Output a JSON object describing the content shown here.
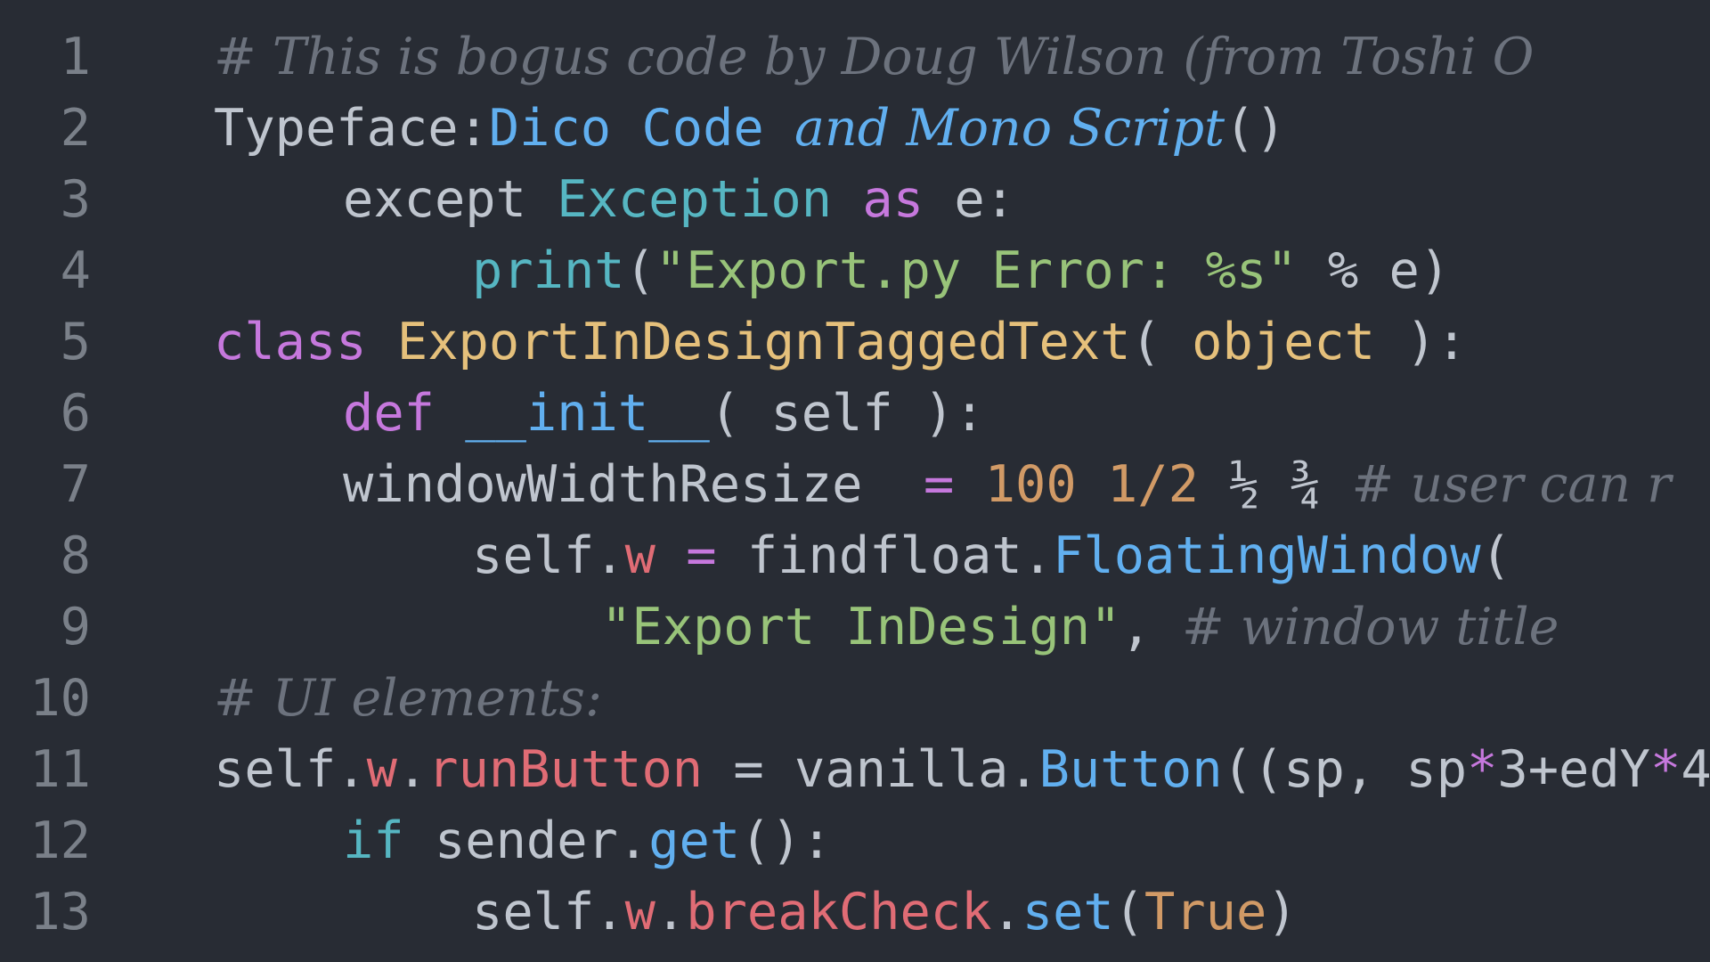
{
  "theme": {
    "background": "#282c34",
    "colors": {
      "default": "#bfc5ce",
      "gutter": "#7a8089",
      "comment": "#6c727d",
      "blue": "#61afef",
      "cyan": "#56b6c2",
      "purple": "#c678dd",
      "green": "#98c379",
      "orange": "#d19a66",
      "yellow": "#e5c07b",
      "red": "#e06c75"
    }
  },
  "lines": [
    {
      "num": "1",
      "indent": 0,
      "tokens": [
        {
          "t": "# This is bogus code by Doug Wilson (from Toshi O",
          "c": "comment"
        }
      ]
    },
    {
      "num": "2",
      "indent": 0,
      "tokens": [
        {
          "t": "Typeface:",
          "c": "default"
        },
        {
          "t": "Dico Code ",
          "c": "blue"
        },
        {
          "t": "and Mono Script",
          "c": "blue",
          "s": "script-italic"
        },
        {
          "t": "()",
          "c": "default"
        }
      ]
    },
    {
      "num": "3",
      "indent": 1,
      "tokens": [
        {
          "t": "except ",
          "c": "default"
        },
        {
          "t": "Exception",
          "c": "cyan"
        },
        {
          "t": " ",
          "c": "default"
        },
        {
          "t": "as",
          "c": "purple"
        },
        {
          "t": " e:",
          "c": "default"
        }
      ]
    },
    {
      "num": "4",
      "indent": 2,
      "tokens": [
        {
          "t": "print",
          "c": "cyan"
        },
        {
          "t": "(",
          "c": "default"
        },
        {
          "t": "\"Export.py Error: %s\"",
          "c": "green"
        },
        {
          "t": " % e)",
          "c": "default"
        }
      ]
    },
    {
      "num": "5",
      "indent": 0,
      "tokens": [
        {
          "t": "class ",
          "c": "purple"
        },
        {
          "t": "ExportInDesignTaggedText",
          "c": "yellow"
        },
        {
          "t": "( ",
          "c": "default"
        },
        {
          "t": "object",
          "c": "yellow"
        },
        {
          "t": " ):",
          "c": "default"
        }
      ]
    },
    {
      "num": "6",
      "indent": 1,
      "tokens": [
        {
          "t": "def ",
          "c": "purple"
        },
        {
          "t": "__init__",
          "c": "blue"
        },
        {
          "t": "( self ):",
          "c": "default"
        }
      ]
    },
    {
      "num": "7",
      "indent": 1,
      "tokens": [
        {
          "t": "windowWidthResize  ",
          "c": "default"
        },
        {
          "t": "=",
          "c": "purple"
        },
        {
          "t": " ",
          "c": "default"
        },
        {
          "t": "100 1/2",
          "c": "orange"
        },
        {
          "t": " ½ ¾ ",
          "c": "default"
        },
        {
          "t": "# user can r",
          "c": "comment"
        }
      ]
    },
    {
      "num": "8",
      "indent": 2,
      "tokens": [
        {
          "t": "self.",
          "c": "default"
        },
        {
          "t": "w",
          "c": "red"
        },
        {
          "t": " ",
          "c": "default"
        },
        {
          "t": "=",
          "c": "purple"
        },
        {
          "t": " findfloat.",
          "c": "default"
        },
        {
          "t": "FloatingWindow",
          "c": "blue"
        },
        {
          "t": "(",
          "c": "default"
        }
      ]
    },
    {
      "num": "9",
      "indent": 3,
      "tokens": [
        {
          "t": "\"Export InDesign\"",
          "c": "green"
        },
        {
          "t": ", ",
          "c": "default"
        },
        {
          "t": "# window title",
          "c": "comment"
        }
      ]
    },
    {
      "num": "10",
      "indent": 0,
      "tokens": [
        {
          "t": "# UI elements:",
          "c": "comment"
        }
      ]
    },
    {
      "num": "11",
      "indent": 0,
      "tokens": [
        {
          "t": "self.",
          "c": "default"
        },
        {
          "t": "w",
          "c": "red"
        },
        {
          "t": ".",
          "c": "default"
        },
        {
          "t": "runButton",
          "c": "red"
        },
        {
          "t": " = vanilla.",
          "c": "default"
        },
        {
          "t": "Button",
          "c": "blue"
        },
        {
          "t": "((sp, sp",
          "c": "default"
        },
        {
          "t": "*",
          "c": "purple"
        },
        {
          "t": "3+edY",
          "c": "default"
        },
        {
          "t": "*",
          "c": "purple"
        },
        {
          "t": "4",
          "c": "default"
        }
      ]
    },
    {
      "num": "12",
      "indent": 1,
      "tokens": [
        {
          "t": "if",
          "c": "cyan"
        },
        {
          "t": " sender.",
          "c": "default"
        },
        {
          "t": "get",
          "c": "blue"
        },
        {
          "t": "():",
          "c": "default"
        }
      ]
    },
    {
      "num": "13",
      "indent": 2,
      "tokens": [
        {
          "t": "self.",
          "c": "default"
        },
        {
          "t": "w",
          "c": "red"
        },
        {
          "t": ".",
          "c": "default"
        },
        {
          "t": "breakCheck",
          "c": "red"
        },
        {
          "t": ".",
          "c": "default"
        },
        {
          "t": "set",
          "c": "blue"
        },
        {
          "t": "(",
          "c": "default"
        },
        {
          "t": "True",
          "c": "orange"
        },
        {
          "t": ")",
          "c": "default"
        }
      ]
    }
  ]
}
